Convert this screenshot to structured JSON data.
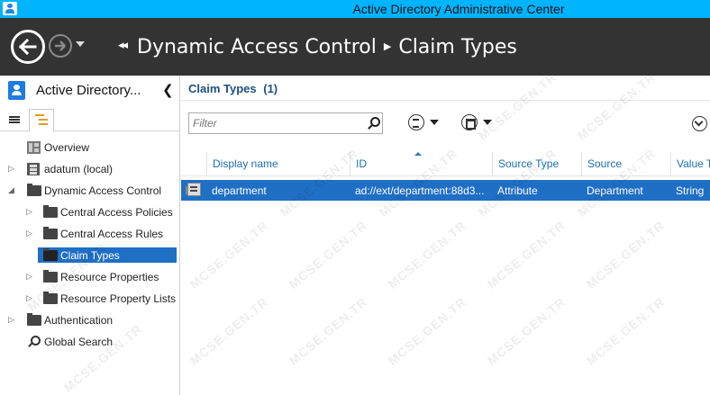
{
  "window": {
    "title": "Active Directory Administrative Center"
  },
  "breadcrumb": {
    "items": [
      "Dynamic Access Control",
      "Claim Types"
    ]
  },
  "left_pane": {
    "title": "Active Directory...",
    "tree": [
      {
        "label": "Overview",
        "icon": "overview-icon"
      },
      {
        "label": "adatum (local)",
        "icon": "domain-icon"
      },
      {
        "label": "Dynamic Access Control",
        "icon": "folder-icon"
      },
      {
        "label": "Central Access Policies",
        "icon": "folder-icon"
      },
      {
        "label": "Central Access Rules",
        "icon": "folder-icon"
      },
      {
        "label": "Claim Types",
        "icon": "folder-icon",
        "selected": true
      },
      {
        "label": "Resource Properties",
        "icon": "folder-icon"
      },
      {
        "label": "Resource Property Lists",
        "icon": "folder-icon"
      },
      {
        "label": "Authentication",
        "icon": "folder-icon"
      },
      {
        "label": "Global Search",
        "icon": "search-icon"
      }
    ]
  },
  "main": {
    "header": {
      "title": "Claim Types",
      "count": "(1)"
    },
    "filter": {
      "placeholder": "Filter"
    },
    "columns": [
      "Display name",
      "ID",
      "Source Type",
      "Source",
      "Value T"
    ],
    "rows": [
      {
        "display_name": "department",
        "id": "ad://ext/department:88d3...",
        "source_type": "Attribute",
        "source": "Department",
        "value_type": "String"
      }
    ]
  },
  "watermark": {
    "text": "MCSE.GEN.TR"
  },
  "colors": {
    "title_bar": "#00b4ff",
    "header": "#333333",
    "selection": "#1f6fc5",
    "column_header_text": "#1f6fb0",
    "main_title": "#1f4f80"
  }
}
